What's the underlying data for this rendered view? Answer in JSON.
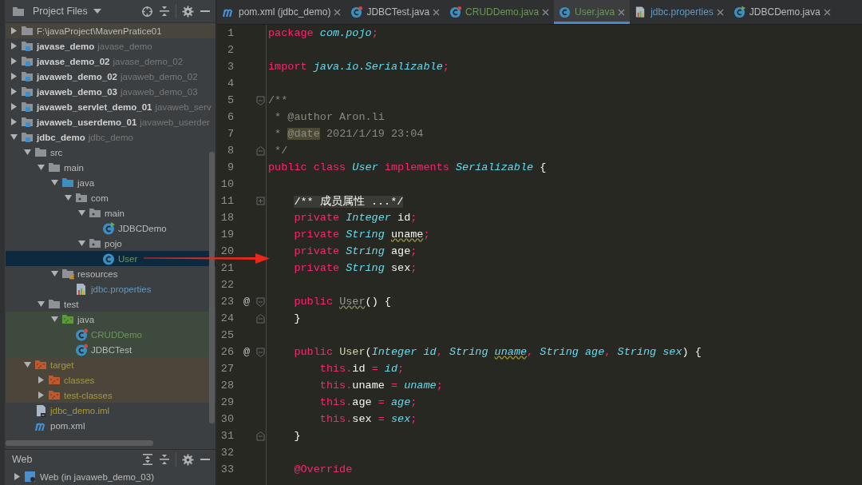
{
  "project": {
    "title": "Project Files",
    "tree": [
      {
        "name": "F:\\javaProject\\MavenPratice01",
        "kind": "root",
        "expanded": false,
        "selected": false
      },
      {
        "name": "javase_demo",
        "module": "javase_demo",
        "kind": "module",
        "expanded": false,
        "selected": false
      },
      {
        "name": "javase_demo_02",
        "module": "javase_demo_02",
        "kind": "module",
        "expanded": false,
        "selected": false
      },
      {
        "name": "javaweb_demo_02",
        "module": "javaweb_demo_02",
        "kind": "module",
        "expanded": false,
        "selected": false
      },
      {
        "name": "javaweb_demo_03",
        "module": "javaweb_demo_03",
        "kind": "module",
        "expanded": false,
        "selected": false
      },
      {
        "name": "javaweb_servlet_demo_01",
        "module": "javaweb_serv",
        "kind": "module",
        "expanded": false,
        "selected": false
      },
      {
        "name": "javaweb_userdemo_01",
        "module": "javaweb_userder",
        "kind": "module",
        "expanded": false,
        "selected": false
      },
      {
        "name": "jdbc_demo",
        "module": "jdbc_demo",
        "kind": "module",
        "expanded": true,
        "selected": false,
        "children": [
          {
            "name": "src",
            "kind": "folder",
            "expanded": true,
            "selected": false,
            "children": [
              {
                "name": "main",
                "kind": "folder",
                "expanded": true,
                "selected": false,
                "children": [
                  {
                    "name": "java",
                    "kind": "source",
                    "expanded": true,
                    "selected": false,
                    "children": [
                      {
                        "name": "com",
                        "kind": "package",
                        "expanded": true,
                        "selected": false,
                        "children": [
                          {
                            "name": "main",
                            "kind": "package",
                            "expanded": true,
                            "selected": false,
                            "children": [
                              {
                                "name": "JDBCDemo",
                                "kind": "main-class",
                                "selected": false
                              }
                            ]
                          },
                          {
                            "name": "pojo",
                            "kind": "package",
                            "expanded": true,
                            "selected": false,
                            "children": [
                              {
                                "name": "User",
                                "kind": "class",
                                "color": "#6a9955",
                                "selected": true
                              }
                            ]
                          }
                        ]
                      }
                    ]
                  },
                  {
                    "name": "resources",
                    "kind": "resources",
                    "expanded": true,
                    "selected": false,
                    "children": [
                      {
                        "name": "jdbc.properties",
                        "kind": "properties",
                        "color": "#6897bb",
                        "selected": false
                      }
                    ]
                  }
                ]
              },
              {
                "name": "test",
                "kind": "folder",
                "expanded": true,
                "selected": false,
                "children": [
                  {
                    "name": "java",
                    "kind": "test-source",
                    "expanded": true,
                    "selected": false,
                    "children": [
                      {
                        "name": "CRUDDemo",
                        "kind": "test-class",
                        "color": "#6a9955",
                        "selected": false
                      },
                      {
                        "name": "JDBCTest",
                        "kind": "test-class",
                        "selected": false
                      }
                    ]
                  }
                ]
              }
            ]
          },
          {
            "name": "target",
            "kind": "excluded",
            "color": "#a89a3a",
            "expanded": true,
            "selected": false,
            "children": [
              {
                "name": "classes",
                "kind": "excluded",
                "color": "#a89a3a",
                "expanded": false,
                "selected": false
              },
              {
                "name": "test-classes",
                "kind": "excluded",
                "color": "#a89a3a",
                "expanded": false,
                "selected": false
              }
            ]
          },
          {
            "name": "jdbc_demo.iml",
            "kind": "iml",
            "color": "#a89a3a",
            "selected": false
          },
          {
            "name": "pom.xml",
            "kind": "maven",
            "selected": false
          }
        ]
      }
    ]
  },
  "web_panel": {
    "title": "Web",
    "items": [
      {
        "name": "Web (in javaweb_demo_03)",
        "expanded": false,
        "selected": false
      }
    ]
  },
  "tabs": [
    {
      "label": "pom.xml (jdbc_demo)",
      "kind": "maven",
      "selected": false
    },
    {
      "label": "JDBCTest.java",
      "kind": "test-class",
      "selected": false
    },
    {
      "label": "CRUDDemo.java",
      "kind": "test-class",
      "color": "#6a9955",
      "selected": false
    },
    {
      "label": "User.java",
      "kind": "class",
      "color": "#6a9955",
      "selected": true
    },
    {
      "label": "jdbc.properties",
      "kind": "properties",
      "color": "#6897bb",
      "selected": false
    },
    {
      "label": "JDBCDemo.java",
      "kind": "main-class",
      "selected": false
    }
  ],
  "code": [
    {
      "number": "1",
      "kind": "text",
      "tokens": [
        {
          "kind": "keyword",
          "text": "package "
        },
        {
          "kind": "type",
          "text": "com.pojo"
        },
        {
          "kind": "keyword",
          "text": ";"
        }
      ]
    },
    {
      "number": "2",
      "kind": "blank"
    },
    {
      "number": "3",
      "kind": "text",
      "tokens": [
        {
          "kind": "keyword",
          "text": "import "
        },
        {
          "kind": "type",
          "text": "java.io.Serializable"
        },
        {
          "kind": "keyword",
          "text": ";"
        }
      ]
    },
    {
      "number": "4",
      "kind": "blank"
    },
    {
      "number": "5",
      "kind": "fold-start",
      "tokens": [
        {
          "kind": "comment",
          "text": "/**"
        }
      ]
    },
    {
      "number": "6",
      "kind": "text",
      "tokens": [
        {
          "kind": "comment",
          "text": " * @author Aron.li"
        }
      ]
    },
    {
      "number": "7",
      "kind": "text",
      "tokens": [
        {
          "kind": "comment",
          "text": " * "
        },
        {
          "kind": "doc-tag",
          "text": "@date"
        },
        {
          "kind": "comment",
          "text": " 2021/1/19 23:04"
        }
      ]
    },
    {
      "number": "8",
      "kind": "fold-end",
      "tokens": [
        {
          "kind": "comment",
          "text": " */"
        }
      ]
    },
    {
      "number": "9",
      "kind": "text",
      "tokens": [
        {
          "kind": "keyword",
          "text": "public class "
        },
        {
          "kind": "type",
          "text": "User"
        },
        {
          "kind": "keyword",
          "text": " implements "
        },
        {
          "kind": "type",
          "text": "Serializable"
        },
        {
          "kind": "plain",
          "text": " {"
        }
      ]
    },
    {
      "number": "10",
      "kind": "blank"
    },
    {
      "number": "11",
      "kind": "folded",
      "tokens": [
        {
          "kind": "folded",
          "text": "/** 成员属性 ...*/"
        }
      ]
    },
    {
      "number": "18",
      "kind": "text",
      "tokens": [
        {
          "kind": "keyword",
          "text": "    private "
        },
        {
          "kind": "type",
          "text": "Integer"
        },
        {
          "kind": "plain",
          "text": " id"
        },
        {
          "kind": "keyword",
          "text": ";"
        }
      ]
    },
    {
      "number": "19",
      "kind": "text",
      "tokens": [
        {
          "kind": "keyword",
          "text": "    private "
        },
        {
          "kind": "type",
          "text": "String "
        },
        {
          "kind": "warning",
          "text": "uname"
        },
        {
          "kind": "keyword",
          "text": ";"
        }
      ]
    },
    {
      "number": "20",
      "kind": "text",
      "tokens": [
        {
          "kind": "keyword",
          "text": "    private "
        },
        {
          "kind": "type",
          "text": "String"
        },
        {
          "kind": "plain",
          "text": " age"
        },
        {
          "kind": "keyword",
          "text": ";"
        }
      ]
    },
    {
      "number": "21",
      "kind": "text",
      "tokens": [
        {
          "kind": "keyword",
          "text": "    private "
        },
        {
          "kind": "type",
          "text": "String"
        },
        {
          "kind": "plain",
          "text": " sex"
        },
        {
          "kind": "keyword",
          "text": ";"
        }
      ]
    },
    {
      "number": "22",
      "kind": "blank"
    },
    {
      "number": "23",
      "gutter": "@",
      "kind": "fold-start",
      "tokens": [
        {
          "kind": "keyword",
          "text": "    public "
        },
        {
          "kind": "unused",
          "text": "User"
        },
        {
          "kind": "plain",
          "text": "() {"
        }
      ]
    },
    {
      "number": "24",
      "kind": "fold-end",
      "tokens": [
        {
          "kind": "plain",
          "text": "    }"
        }
      ]
    },
    {
      "number": "25",
      "kind": "blank"
    },
    {
      "number": "26",
      "gutter": "@",
      "kind": "fold-start",
      "tokens": [
        {
          "kind": "keyword",
          "text": "    public "
        },
        {
          "kind": "method",
          "text": "User"
        },
        {
          "kind": "plain",
          "text": "("
        },
        {
          "kind": "type",
          "text": "Integer"
        },
        {
          "kind": "param",
          "text": " id"
        },
        {
          "kind": "keyword",
          "text": ", "
        },
        {
          "kind": "type",
          "text": "String "
        },
        {
          "kind": "param-warning",
          "text": "uname"
        },
        {
          "kind": "keyword",
          "text": ", "
        },
        {
          "kind": "type",
          "text": "String"
        },
        {
          "kind": "param",
          "text": " age"
        },
        {
          "kind": "keyword",
          "text": ", "
        },
        {
          "kind": "type",
          "text": "String"
        },
        {
          "kind": "param",
          "text": " sex"
        },
        {
          "kind": "plain",
          "text": ") {"
        }
      ]
    },
    {
      "number": "27",
      "kind": "text",
      "tokens": [
        {
          "kind": "keyword",
          "text": "        this."
        },
        {
          "kind": "plain",
          "text": "id "
        },
        {
          "kind": "keyword",
          "text": "= "
        },
        {
          "kind": "param",
          "text": "id"
        },
        {
          "kind": "keyword",
          "text": ";"
        }
      ]
    },
    {
      "number": "28",
      "kind": "text",
      "tokens": [
        {
          "kind": "keyword",
          "text": "        this."
        },
        {
          "kind": "plain",
          "text": "uname "
        },
        {
          "kind": "keyword",
          "text": "= "
        },
        {
          "kind": "param",
          "text": "uname"
        },
        {
          "kind": "keyword",
          "text": ";"
        }
      ]
    },
    {
      "number": "29",
      "kind": "text",
      "tokens": [
        {
          "kind": "keyword",
          "text": "        this."
        },
        {
          "kind": "plain",
          "text": "age "
        },
        {
          "kind": "keyword",
          "text": "= "
        },
        {
          "kind": "param",
          "text": "age"
        },
        {
          "kind": "keyword",
          "text": ";"
        }
      ]
    },
    {
      "number": "30",
      "kind": "text",
      "tokens": [
        {
          "kind": "keyword",
          "text": "        this."
        },
        {
          "kind": "plain",
          "text": "sex "
        },
        {
          "kind": "keyword",
          "text": "= "
        },
        {
          "kind": "param",
          "text": "sex"
        },
        {
          "kind": "keyword",
          "text": ";"
        }
      ]
    },
    {
      "number": "31",
      "kind": "fold-end",
      "tokens": [
        {
          "kind": "plain",
          "text": "    }"
        }
      ]
    },
    {
      "number": "32",
      "kind": "blank"
    },
    {
      "number": "33",
      "kind": "text",
      "tokens": [
        {
          "kind": "annotation",
          "text": "    @Override"
        }
      ]
    }
  ]
}
